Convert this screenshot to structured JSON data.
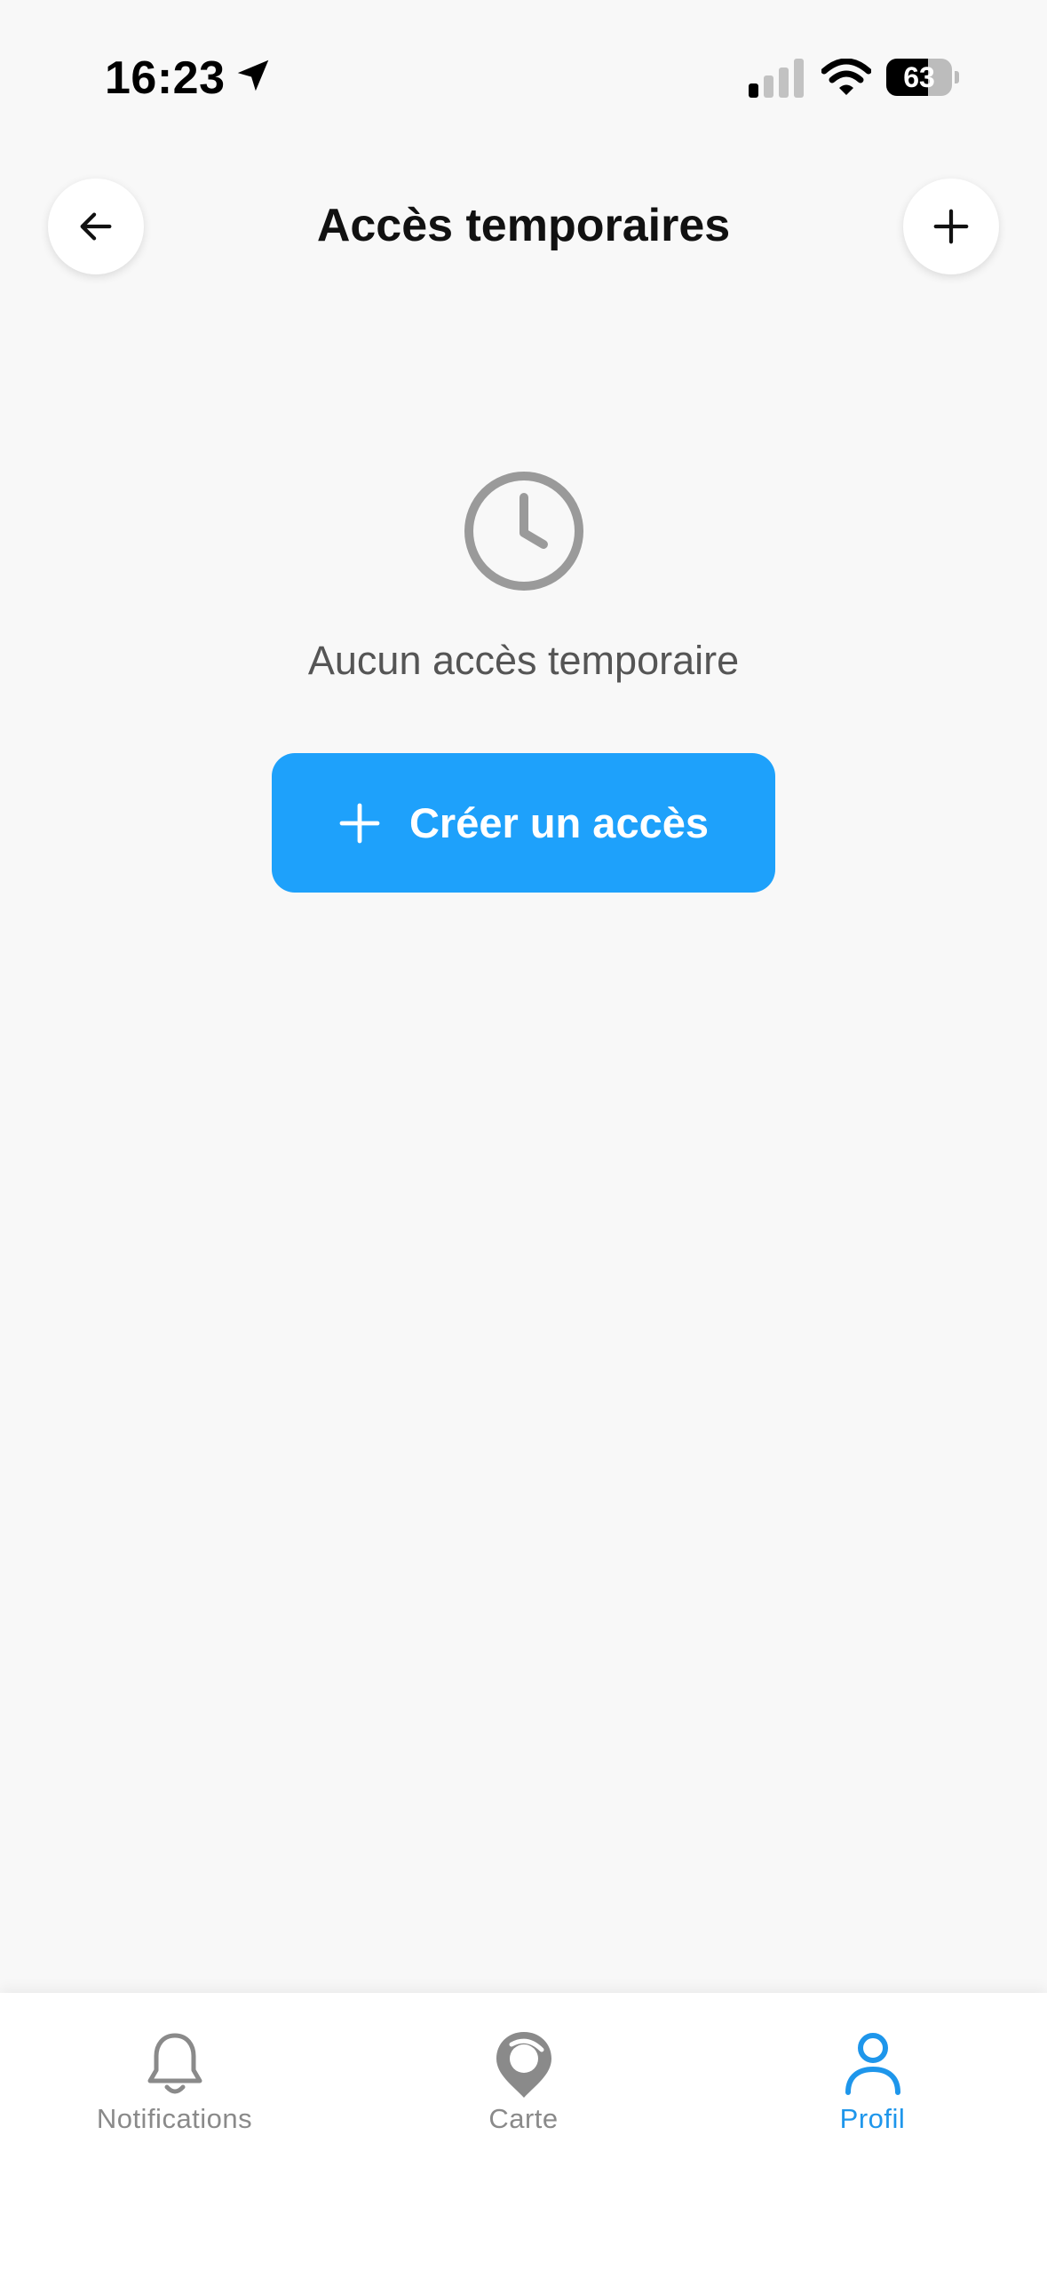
{
  "status_bar": {
    "time": "16:23",
    "battery_percent": "63",
    "battery_level": 0.63,
    "icons": [
      "location-arrow-icon",
      "cellular-signal-icon",
      "wifi-icon",
      "battery-icon"
    ]
  },
  "header": {
    "title": "Accès temporaires",
    "back_icon": "arrow-left-icon",
    "add_icon": "plus-icon"
  },
  "empty_state": {
    "icon": "clock-icon",
    "message": "Aucun accès temporaire",
    "create_button_label": "Créer un accès",
    "create_button_icon": "plus-icon"
  },
  "tab_bar": {
    "tabs": [
      {
        "label": "Notifications",
        "icon": "bell-icon",
        "active": false
      },
      {
        "label": "Carte",
        "icon": "map-pin-icon",
        "active": false
      },
      {
        "label": "Profil",
        "icon": "user-icon",
        "active": true
      }
    ]
  },
  "colors": {
    "background": "#f8f8f8",
    "accent": "#1ea1fb",
    "active_tab": "#1e96eb",
    "inactive_tab": "#8a8a8a",
    "muted_text": "#555555"
  }
}
